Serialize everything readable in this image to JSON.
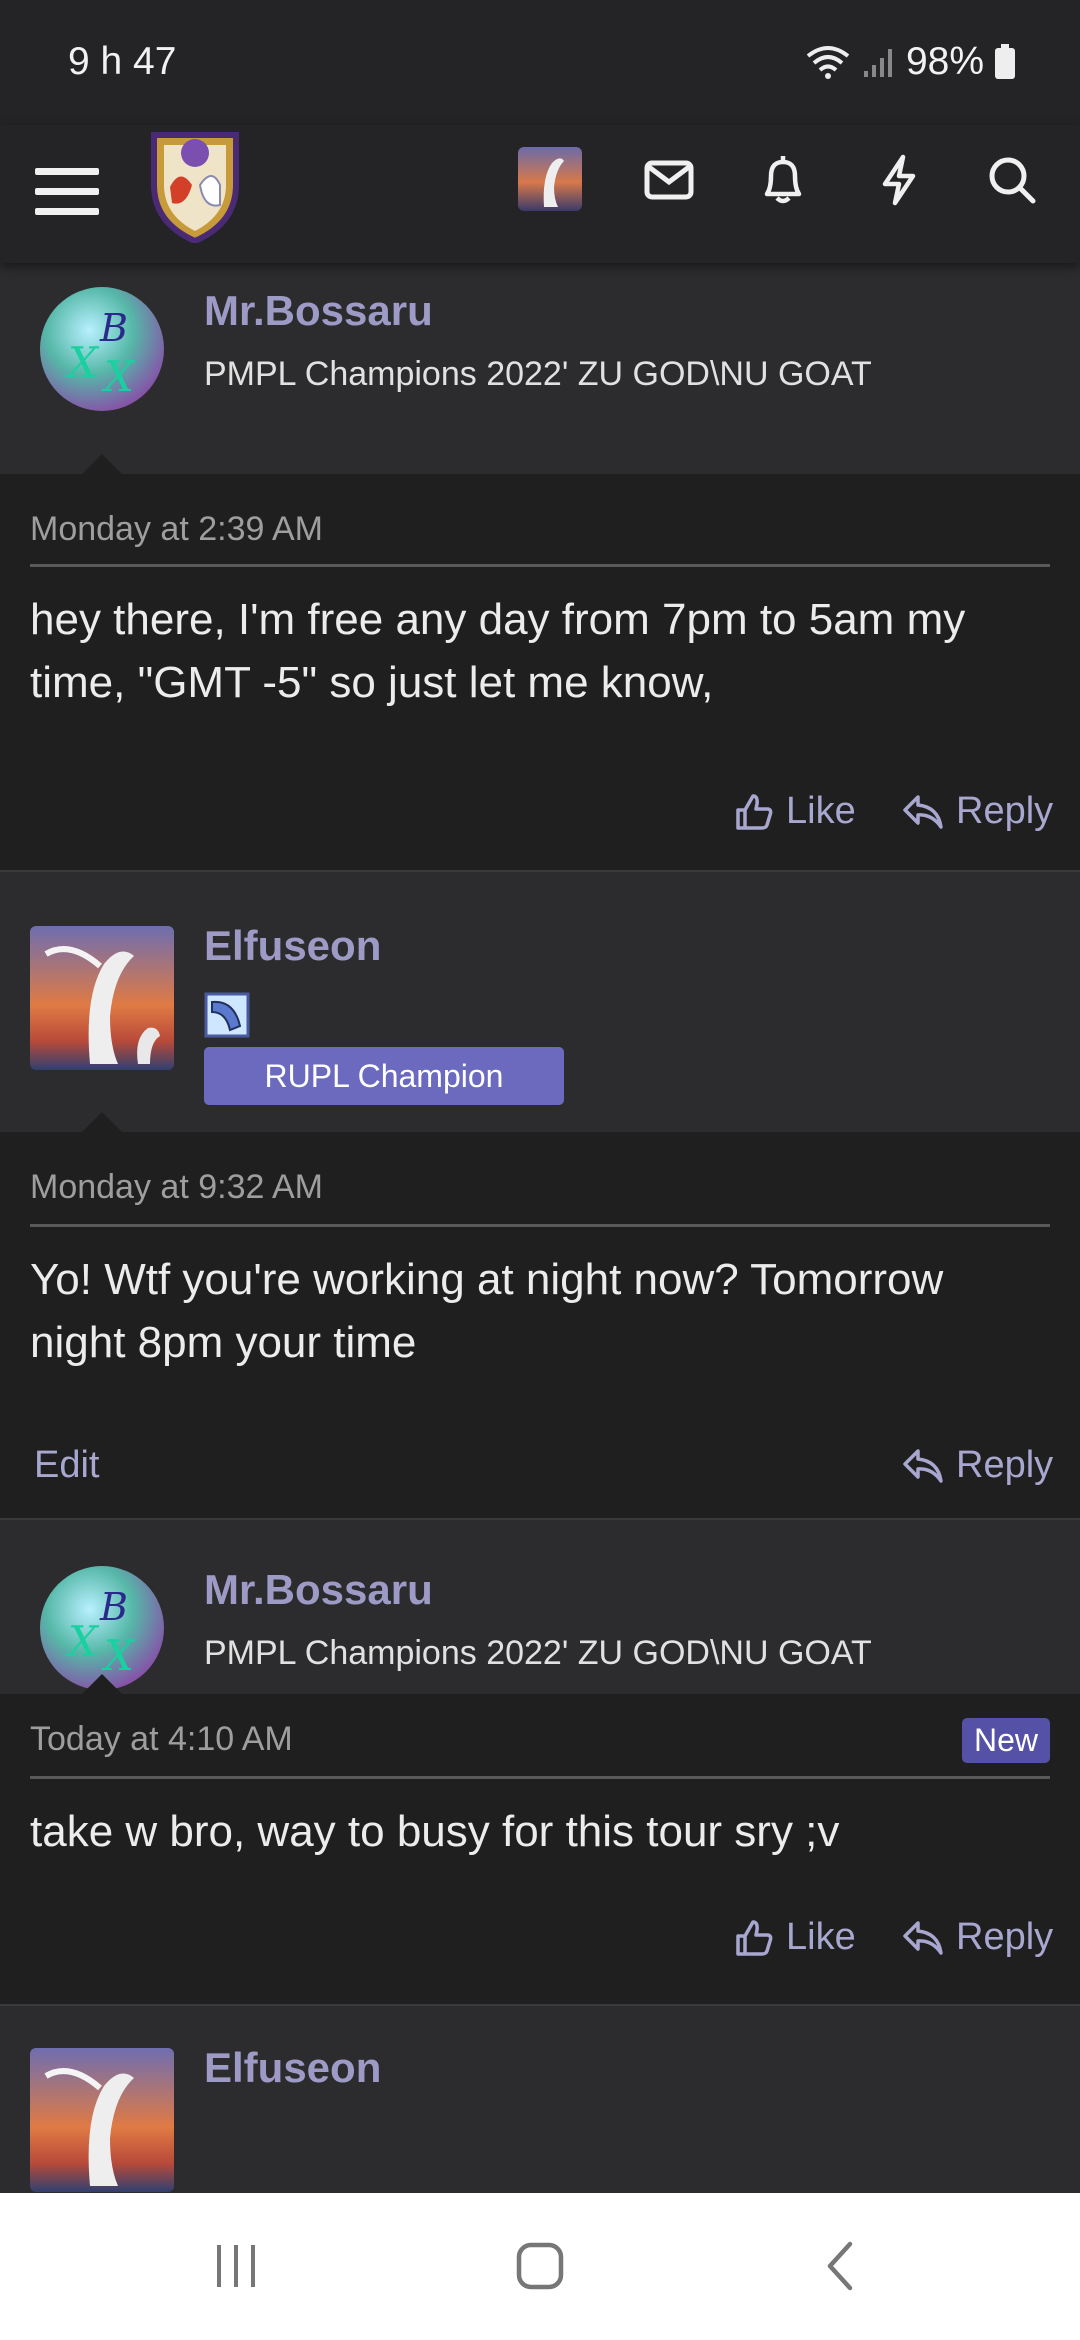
{
  "status_bar": {
    "time": "9 h 47",
    "battery": "98%"
  },
  "nav": {
    "menu_icon": "hamburger-menu-icon",
    "logo_icon": "forum-crest-logo",
    "icons": [
      "user-avatar",
      "envelope-icon",
      "bell-icon",
      "lightning-icon",
      "search-icon"
    ]
  },
  "posts": [
    {
      "username": "Mr.Bossaru",
      "user_title": "PMPL Champions 2022' ZU GOD\\NU GOAT",
      "date": "Monday at 2:39 AM",
      "message": "hey there, I'm free any day from 7pm to 5am my time, \"GMT -5\" so just let me know,",
      "like_label": "Like",
      "reply_label": "Reply"
    },
    {
      "username": "Elfuseon",
      "rank_banner": "RUPL Champion",
      "date": "Monday at 9:32 AM",
      "message": "Yo! Wtf you're working at night now? Tomorrow night 8pm your time",
      "edit_label": "Edit",
      "reply_label": "Reply"
    },
    {
      "username": "Mr.Bossaru",
      "user_title": "PMPL Champions 2022' ZU GOD\\NU GOAT",
      "date": "Today at 4:10 AM",
      "new_badge": "New",
      "message": "take w bro, way to busy for this tour sry ;v",
      "like_label": "Like",
      "reply_label": "Reply"
    },
    {
      "username": "Elfuseon"
    }
  ],
  "colors": {
    "background": "#242426",
    "post_body": "#1f1f20",
    "username": "#9d9bc6",
    "accent": "#6b6abf",
    "new_badge": "#5451a6"
  }
}
